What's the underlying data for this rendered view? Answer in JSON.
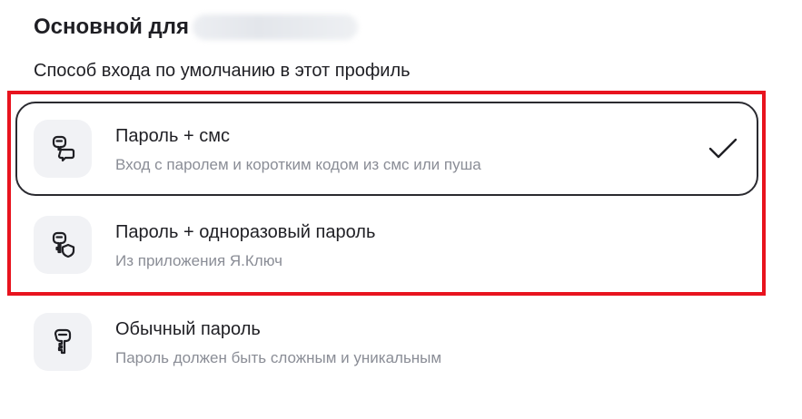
{
  "header": {
    "title_prefix": "Основной для",
    "subtitle": "Способ входа по умолчанию в этот профиль"
  },
  "options": [
    {
      "title": "Пароль + смс",
      "description": "Вход с паролем и коротким кодом из смс или пуша",
      "icon": "key-sms-icon",
      "selected": true
    },
    {
      "title": "Пароль + одноразовый пароль",
      "description": "Из приложения Я.Ключ",
      "icon": "key-shield-icon",
      "selected": false
    },
    {
      "title": "Обычный пароль",
      "description": "Пароль должен быть сложным и уникальным",
      "icon": "key-icon",
      "selected": false
    }
  ],
  "colors": {
    "highlight": "#e8131e",
    "selected_border": "#2a2a30",
    "icon_bg": "#f1f2f5",
    "description_text": "#8a8d96"
  }
}
